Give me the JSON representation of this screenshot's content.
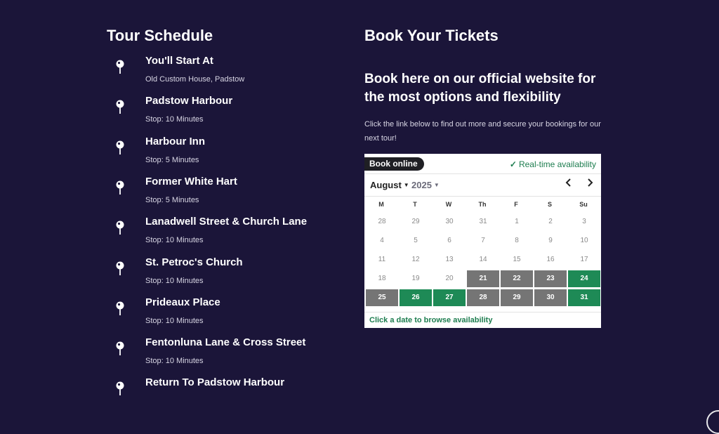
{
  "schedule": {
    "title": "Tour Schedule",
    "stops": [
      {
        "name": "You'll Start At",
        "detail": "Old Custom House, Padstow"
      },
      {
        "name": "Padstow Harbour",
        "detail": "Stop: 10 Minutes"
      },
      {
        "name": "Harbour Inn",
        "detail": "Stop: 5 Minutes"
      },
      {
        "name": "Former White Hart",
        "detail": "Stop: 5 Minutes"
      },
      {
        "name": "Lanadwell Street & Church Lane",
        "detail": "Stop: 10 Minutes"
      },
      {
        "name": "St. Petroc's Church",
        "detail": "Stop: 10 Minutes"
      },
      {
        "name": "Prideaux Place",
        "detail": "Stop: 10 Minutes"
      },
      {
        "name": "Fentonluna Lane & Cross Street",
        "detail": "Stop: 10 Minutes"
      },
      {
        "name": "Return To Padstow Harbour",
        "detail": ""
      }
    ]
  },
  "booking": {
    "title": "Book Your Tickets",
    "subhead": "Book here on our official website for the most options and flexibility",
    "intro": "Click the link below to find out more and secure your bookings for our next tour!",
    "widget": {
      "book_label": "Book online",
      "realtime_label": "Real-time availability",
      "month": "August",
      "year": "2025",
      "weekdays": [
        "M",
        "T",
        "W",
        "Th",
        "F",
        "S",
        "Su"
      ],
      "weeks": [
        [
          {
            "d": "28",
            "s": "past"
          },
          {
            "d": "29",
            "s": "past"
          },
          {
            "d": "30",
            "s": "past"
          },
          {
            "d": "31",
            "s": "past"
          },
          {
            "d": "1",
            "s": "past"
          },
          {
            "d": "2",
            "s": "past"
          },
          {
            "d": "3",
            "s": "past"
          }
        ],
        [
          {
            "d": "4",
            "s": "past"
          },
          {
            "d": "5",
            "s": "past"
          },
          {
            "d": "6",
            "s": "past"
          },
          {
            "d": "7",
            "s": "past"
          },
          {
            "d": "8",
            "s": "past"
          },
          {
            "d": "9",
            "s": "past"
          },
          {
            "d": "10",
            "s": "past"
          }
        ],
        [
          {
            "d": "11",
            "s": "past"
          },
          {
            "d": "12",
            "s": "past"
          },
          {
            "d": "13",
            "s": "past"
          },
          {
            "d": "14",
            "s": "past"
          },
          {
            "d": "15",
            "s": "past"
          },
          {
            "d": "16",
            "s": "past"
          },
          {
            "d": "17",
            "s": "past"
          }
        ],
        [
          {
            "d": "18",
            "s": "past"
          },
          {
            "d": "19",
            "s": "past"
          },
          {
            "d": "20",
            "s": "past"
          },
          {
            "d": "21",
            "s": "closed"
          },
          {
            "d": "22",
            "s": "closed"
          },
          {
            "d": "23",
            "s": "closed"
          },
          {
            "d": "24",
            "s": "open"
          }
        ],
        [
          {
            "d": "25",
            "s": "closed"
          },
          {
            "d": "26",
            "s": "open"
          },
          {
            "d": "27",
            "s": "open"
          },
          {
            "d": "28",
            "s": "closed"
          },
          {
            "d": "29",
            "s": "closed"
          },
          {
            "d": "30",
            "s": "closed"
          },
          {
            "d": "31",
            "s": "open"
          }
        ]
      ],
      "footer": "Click a date to browse availability",
      "colors": {
        "open": "#1e8a56",
        "closed": "#757575",
        "accent": "#1d7d4f"
      },
      "icons": {
        "prev": "chevron-left-icon",
        "next": "chevron-right-icon",
        "check": "check-icon"
      }
    }
  },
  "page": {
    "background": "#1b1539"
  }
}
